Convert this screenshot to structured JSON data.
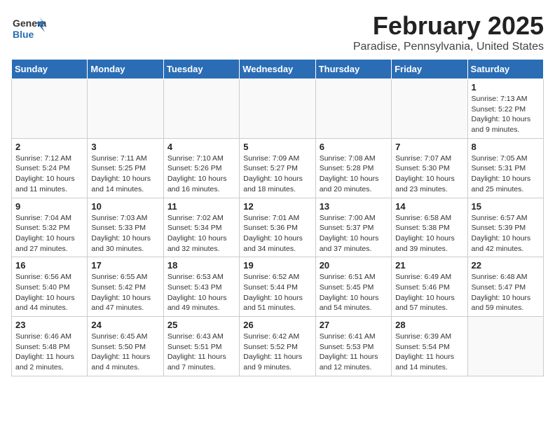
{
  "header": {
    "logo_general": "General",
    "logo_blue": "Blue",
    "title": "February 2025",
    "subtitle": "Paradise, Pennsylvania, United States"
  },
  "weekdays": [
    "Sunday",
    "Monday",
    "Tuesday",
    "Wednesday",
    "Thursday",
    "Friday",
    "Saturday"
  ],
  "weeks": [
    [
      {
        "day": "",
        "info": ""
      },
      {
        "day": "",
        "info": ""
      },
      {
        "day": "",
        "info": ""
      },
      {
        "day": "",
        "info": ""
      },
      {
        "day": "",
        "info": ""
      },
      {
        "day": "",
        "info": ""
      },
      {
        "day": "1",
        "info": "Sunrise: 7:13 AM\nSunset: 5:22 PM\nDaylight: 10 hours\nand 9 minutes."
      }
    ],
    [
      {
        "day": "2",
        "info": "Sunrise: 7:12 AM\nSunset: 5:24 PM\nDaylight: 10 hours\nand 11 minutes."
      },
      {
        "day": "3",
        "info": "Sunrise: 7:11 AM\nSunset: 5:25 PM\nDaylight: 10 hours\nand 14 minutes."
      },
      {
        "day": "4",
        "info": "Sunrise: 7:10 AM\nSunset: 5:26 PM\nDaylight: 10 hours\nand 16 minutes."
      },
      {
        "day": "5",
        "info": "Sunrise: 7:09 AM\nSunset: 5:27 PM\nDaylight: 10 hours\nand 18 minutes."
      },
      {
        "day": "6",
        "info": "Sunrise: 7:08 AM\nSunset: 5:28 PM\nDaylight: 10 hours\nand 20 minutes."
      },
      {
        "day": "7",
        "info": "Sunrise: 7:07 AM\nSunset: 5:30 PM\nDaylight: 10 hours\nand 23 minutes."
      },
      {
        "day": "8",
        "info": "Sunrise: 7:05 AM\nSunset: 5:31 PM\nDaylight: 10 hours\nand 25 minutes."
      }
    ],
    [
      {
        "day": "9",
        "info": "Sunrise: 7:04 AM\nSunset: 5:32 PM\nDaylight: 10 hours\nand 27 minutes."
      },
      {
        "day": "10",
        "info": "Sunrise: 7:03 AM\nSunset: 5:33 PM\nDaylight: 10 hours\nand 30 minutes."
      },
      {
        "day": "11",
        "info": "Sunrise: 7:02 AM\nSunset: 5:34 PM\nDaylight: 10 hours\nand 32 minutes."
      },
      {
        "day": "12",
        "info": "Sunrise: 7:01 AM\nSunset: 5:36 PM\nDaylight: 10 hours\nand 34 minutes."
      },
      {
        "day": "13",
        "info": "Sunrise: 7:00 AM\nSunset: 5:37 PM\nDaylight: 10 hours\nand 37 minutes."
      },
      {
        "day": "14",
        "info": "Sunrise: 6:58 AM\nSunset: 5:38 PM\nDaylight: 10 hours\nand 39 minutes."
      },
      {
        "day": "15",
        "info": "Sunrise: 6:57 AM\nSunset: 5:39 PM\nDaylight: 10 hours\nand 42 minutes."
      }
    ],
    [
      {
        "day": "16",
        "info": "Sunrise: 6:56 AM\nSunset: 5:40 PM\nDaylight: 10 hours\nand 44 minutes."
      },
      {
        "day": "17",
        "info": "Sunrise: 6:55 AM\nSunset: 5:42 PM\nDaylight: 10 hours\nand 47 minutes."
      },
      {
        "day": "18",
        "info": "Sunrise: 6:53 AM\nSunset: 5:43 PM\nDaylight: 10 hours\nand 49 minutes."
      },
      {
        "day": "19",
        "info": "Sunrise: 6:52 AM\nSunset: 5:44 PM\nDaylight: 10 hours\nand 51 minutes."
      },
      {
        "day": "20",
        "info": "Sunrise: 6:51 AM\nSunset: 5:45 PM\nDaylight: 10 hours\nand 54 minutes."
      },
      {
        "day": "21",
        "info": "Sunrise: 6:49 AM\nSunset: 5:46 PM\nDaylight: 10 hours\nand 57 minutes."
      },
      {
        "day": "22",
        "info": "Sunrise: 6:48 AM\nSunset: 5:47 PM\nDaylight: 10 hours\nand 59 minutes."
      }
    ],
    [
      {
        "day": "23",
        "info": "Sunrise: 6:46 AM\nSunset: 5:48 PM\nDaylight: 11 hours\nand 2 minutes."
      },
      {
        "day": "24",
        "info": "Sunrise: 6:45 AM\nSunset: 5:50 PM\nDaylight: 11 hours\nand 4 minutes."
      },
      {
        "day": "25",
        "info": "Sunrise: 6:43 AM\nSunset: 5:51 PM\nDaylight: 11 hours\nand 7 minutes."
      },
      {
        "day": "26",
        "info": "Sunrise: 6:42 AM\nSunset: 5:52 PM\nDaylight: 11 hours\nand 9 minutes."
      },
      {
        "day": "27",
        "info": "Sunrise: 6:41 AM\nSunset: 5:53 PM\nDaylight: 11 hours\nand 12 minutes."
      },
      {
        "day": "28",
        "info": "Sunrise: 6:39 AM\nSunset: 5:54 PM\nDaylight: 11 hours\nand 14 minutes."
      },
      {
        "day": "",
        "info": ""
      }
    ]
  ]
}
